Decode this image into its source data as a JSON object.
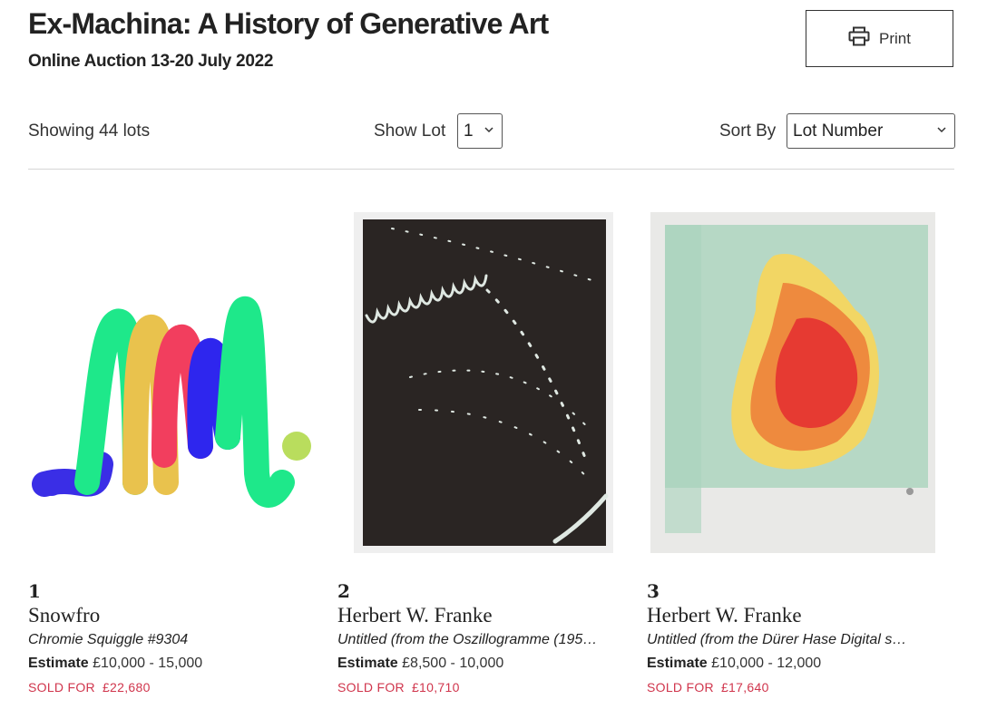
{
  "header": {
    "title": "Ex-Machina: A History of Generative Art",
    "subtitle": "Online Auction 13-20 July 2022",
    "print_label": "Print"
  },
  "toolbar": {
    "showing": "Showing 44 lots",
    "show_lot_label": "Show Lot",
    "show_lot_value": "1",
    "sort_by_label": "Sort By",
    "sort_by_value": "Lot Number"
  },
  "lots": [
    {
      "number": "1",
      "artist": "Snowfro",
      "work": "Chromie Squiggle #9304",
      "estimate_label": "Estimate",
      "estimate": "£10,000 - 15,000",
      "sold_label": "SOLD FOR",
      "sold_amount": "£22,680"
    },
    {
      "number": "2",
      "artist": "Herbert W. Franke",
      "work": "Untitled (from the Oszillogramme (195…",
      "estimate_label": "Estimate",
      "estimate": "£8,500 - 10,000",
      "sold_label": "SOLD FOR",
      "sold_amount": "£10,710"
    },
    {
      "number": "3",
      "artist": "Herbert W. Franke",
      "work": "Untitled (from the Dürer Hase Digital s…",
      "estimate_label": "Estimate",
      "estimate": "£10,000 - 12,000",
      "sold_label": "SOLD FOR",
      "sold_amount": "£17,640"
    }
  ],
  "colors": {
    "sold": "#d0354c",
    "divider": "#d6d6d6",
    "text": "#222222"
  },
  "icons": {
    "print": "printer-icon",
    "select_arrow": "chevron-down-icon"
  }
}
